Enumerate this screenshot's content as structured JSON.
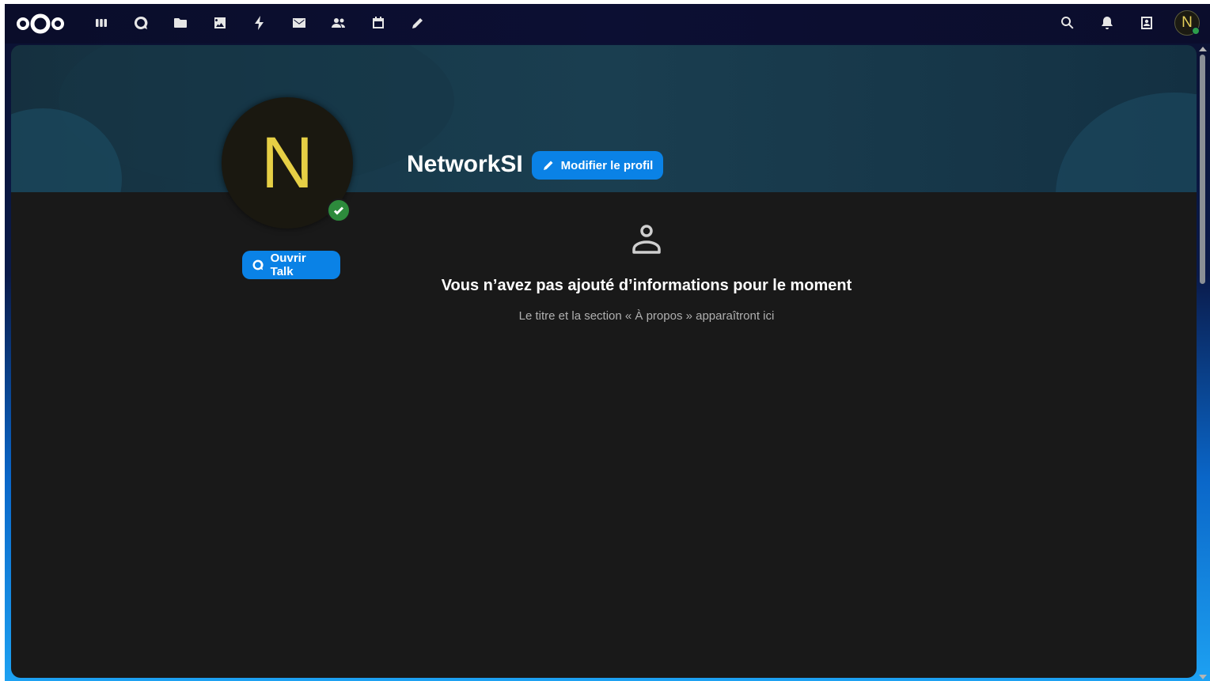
{
  "header": {
    "logo": "nextcloud-logo",
    "apps": [
      {
        "name": "dashboard",
        "icon": "dashboard-icon"
      },
      {
        "name": "talk",
        "icon": "talk-icon"
      },
      {
        "name": "files",
        "icon": "folder-icon"
      },
      {
        "name": "photos",
        "icon": "image-icon"
      },
      {
        "name": "activity",
        "icon": "lightning-icon"
      },
      {
        "name": "mail",
        "icon": "mail-icon"
      },
      {
        "name": "contacts",
        "icon": "contacts-icon"
      },
      {
        "name": "calendar",
        "icon": "calendar-icon"
      },
      {
        "name": "notes",
        "icon": "pencil-icon"
      }
    ],
    "right_icons": [
      "search-icon",
      "bell-icon",
      "contacts-menu-icon"
    ],
    "avatar_initial": "N"
  },
  "profile": {
    "avatar_initial": "N",
    "display_name": "NetworkSI",
    "edit_button": "Modifier le profil",
    "talk_button": "Ouvrir Talk",
    "empty_title": "Vous n’avez pas ajouté d’informations pour le moment",
    "empty_subtitle": "Le titre et la section « À propos » apparaîtront ici"
  },
  "colors": {
    "accent": "#0a82e6",
    "status_online": "#2d8a3c",
    "avatar_letter": "#e6cf45",
    "content_bg": "#191919"
  }
}
